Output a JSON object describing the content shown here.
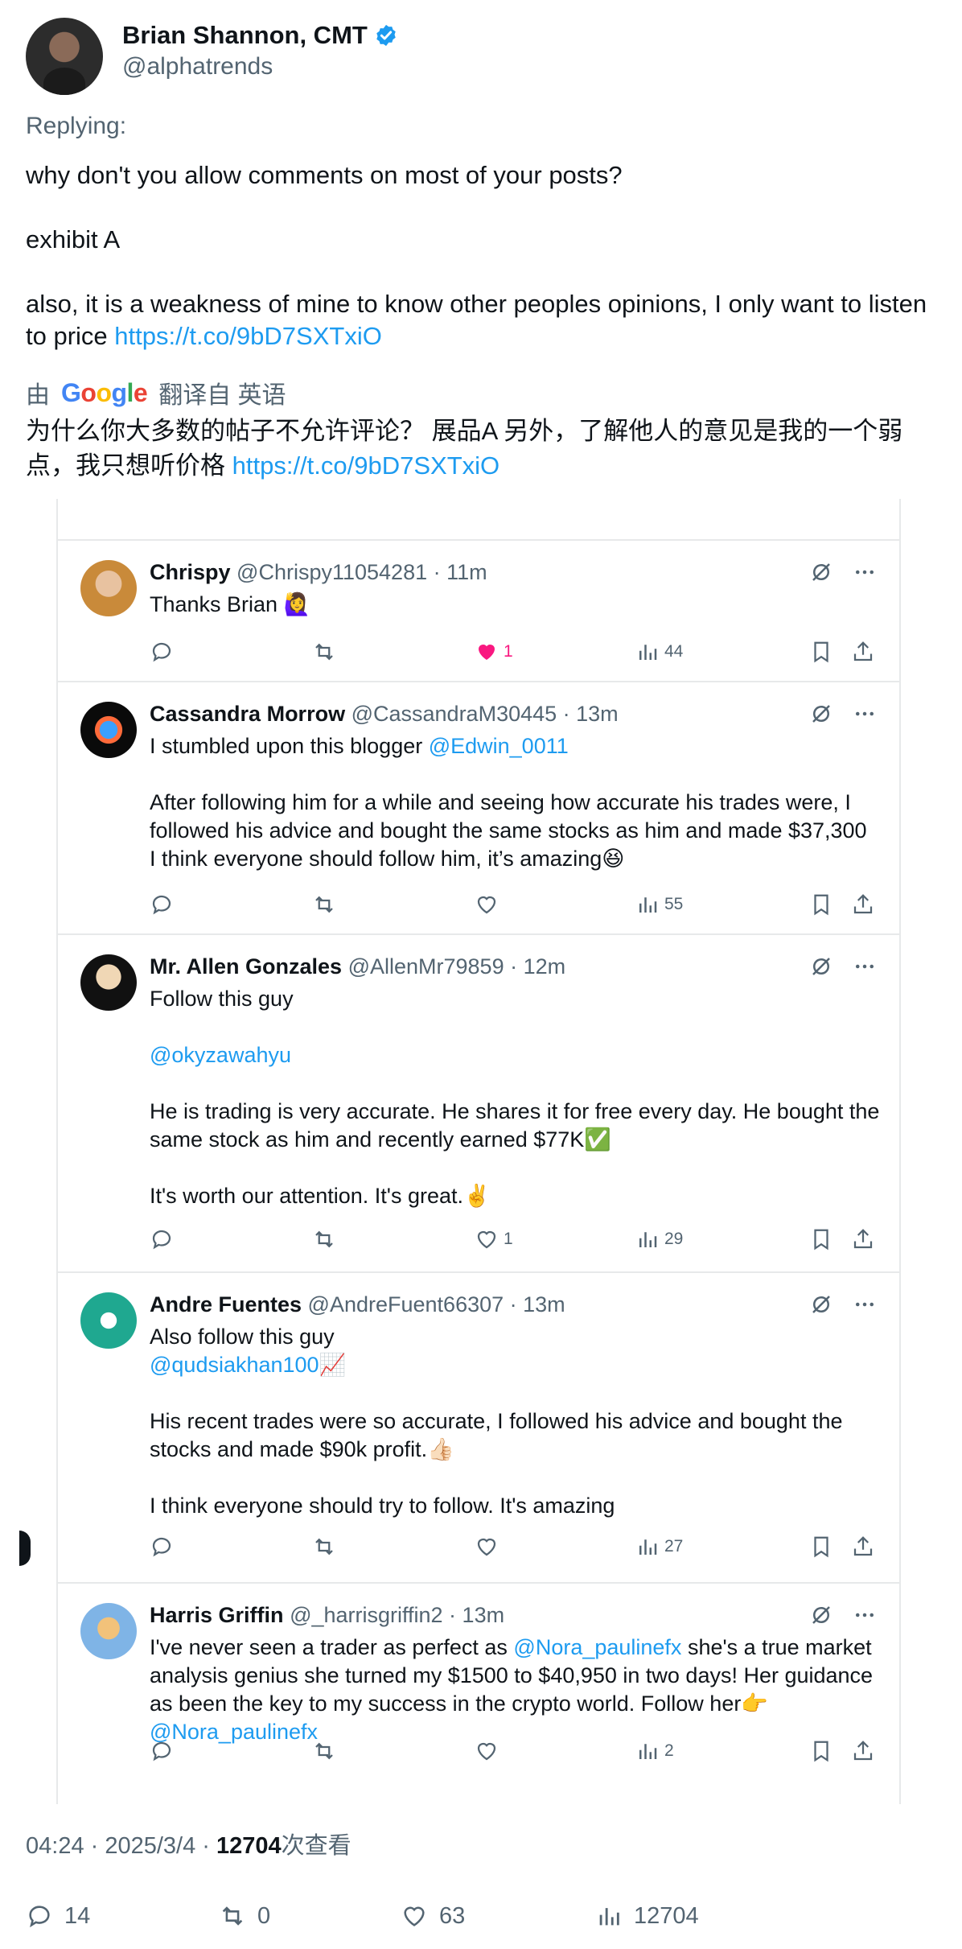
{
  "author": {
    "name": "Brian Shannon, CMT",
    "handle": "@alphatrends"
  },
  "replying_label": "Replying:",
  "post": {
    "line1": "why don't you allow comments on most of your posts?",
    "line2": "exhibit A",
    "line3": "also, it is a weakness of mine to know other peoples opinions, I only want to listen to price",
    "link": "https://t.co/9bD7SXTxiO"
  },
  "translation": {
    "by": "由",
    "google": [
      "G",
      "o",
      "o",
      "g",
      "l",
      "e"
    ],
    "from_label": "翻译自 英语",
    "text": "为什么你大多数的帖子不允许评论？ 展品A 另外，了解他人的意见是我的一个弱点，我只想听价格",
    "link": "https://t.co/9bD7SXTxiO"
  },
  "comments": [
    {
      "name": "Chrispy",
      "meta": "@Chrispy11054281 · 11m",
      "lines": [
        "Thanks Brian 🙋‍♀️"
      ],
      "likes": "1",
      "views": "44",
      "liked": true
    },
    {
      "name": "Cassandra Morrow",
      "meta": "@CassandraM30445 · 13m",
      "lines": [
        "I stumbled upon this blogger ",
        "",
        "After following him for a while and seeing how accurate his trades were, I",
        "followed his advice and bought the same stocks as him and made $37,300",
        "I think everyone should follow him, it’s amazing😆"
      ],
      "mention": "@Edwin_0011",
      "likes": "",
      "views": "55",
      "liked": false
    },
    {
      "name": "Mr. Allen Gonzales",
      "meta": "@AllenMr79859 · 12m",
      "lines": [
        "Follow this guy",
        "",
        "@okyzawahyu",
        "",
        "He is trading is very accurate. He shares it for free every day. He bought the",
        "same stock as him and recently earned $77K✅",
        "",
        "It's worth our attention. It's great.✌️"
      ],
      "likes": "1",
      "views": "29",
      "liked": false
    },
    {
      "name": "Andre Fuentes",
      "meta": "@AndreFuent66307 · 13m",
      "lines": [
        "Also follow this guy",
        " @qudsiakhan100📈",
        "",
        "His recent trades were so accurate, I followed his advice and bought the",
        "stocks and made $90k profit.👍🏻",
        "",
        "I think everyone should try to follow. It's amazing"
      ],
      "likes": "",
      "views": "27",
      "liked": false
    },
    {
      "name": "Harris Griffin",
      "meta": "@_harrisgriffin2 · 13m",
      "lines": [
        "I've never seen a trader as perfect as ",
        "analysis genius she turned my $1500 to $40,950 in two days! Her guidance",
        "as been the key to my success in the crypto world. Follow her👉",
        "@Nora_paulinefx"
      ],
      "mention": "@Nora_paulinefx",
      "line1_tail": " she's a true market",
      "likes": "",
      "views": "2",
      "liked": false
    }
  ],
  "footer": {
    "time": "04:24 · 2025/3/4 · ",
    "views_count": "12704",
    "views_label": "次查看",
    "replies": "14",
    "reposts": "0",
    "likes": "63",
    "views": "12704"
  },
  "colors": {
    "accent": "#1d9bf0",
    "like": "#f91880",
    "muted": "#536471",
    "text": "#0f1419"
  }
}
